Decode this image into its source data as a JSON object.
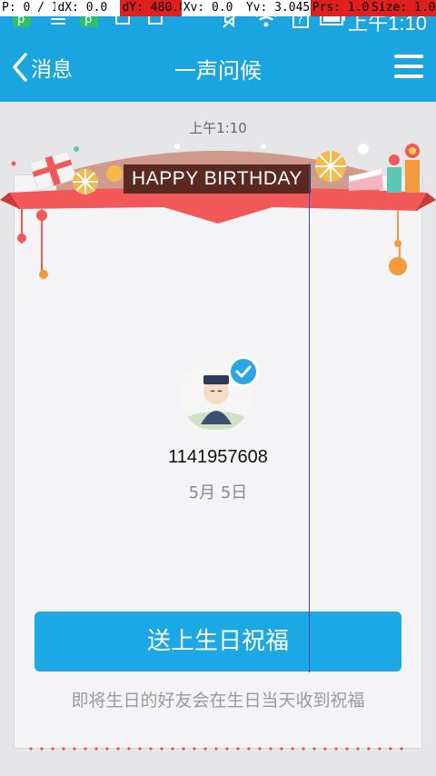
{
  "debug_bar": {
    "pointer": "P: 0 / 1",
    "dx": "dX: 0.0",
    "dy": "dY: 480.0",
    "xv": "Xv: 0.0",
    "yv": "Yv: 3.045",
    "prs": "Prs: 1.0",
    "size": "Size: 1.0"
  },
  "status_bar": {
    "time": "上午1:10"
  },
  "titlebar": {
    "back_label": "消息",
    "title": "一声问候"
  },
  "chat": {
    "timestamp": "上午1:10"
  },
  "card": {
    "banner_text": "HAPPY BIRTHDAY",
    "user_id": "1141957608",
    "birthday": "5月 5日",
    "cta_label": "送上生日祝福",
    "hint": "即将生日的好友会在生日当天收到祝福"
  },
  "colors": {
    "primary": "#1aa4e0",
    "banner_bg": "#5a2a22",
    "ribbon": "#f25858",
    "badge": "#2aa6e6"
  }
}
